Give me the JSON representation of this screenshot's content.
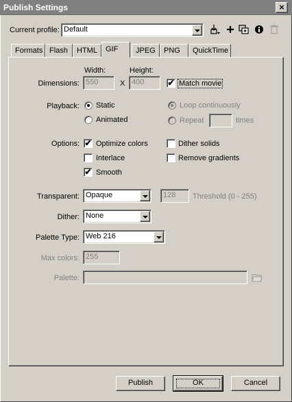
{
  "window": {
    "title": "Publish Settings",
    "close_glyph": "×"
  },
  "profile": {
    "label": "Current profile:",
    "value": "Default",
    "icons": [
      "import-export-icon",
      "add-profile-icon",
      "duplicate-profile-icon",
      "info-icon",
      "delete-profile-icon"
    ]
  },
  "tabs": [
    {
      "label": "Formats",
      "active": false
    },
    {
      "label": "Flash",
      "active": false
    },
    {
      "label": "HTML",
      "active": false
    },
    {
      "label": "GIF",
      "active": true
    },
    {
      "label": "JPEG",
      "active": false
    },
    {
      "label": "PNG",
      "active": false
    },
    {
      "label": "QuickTime",
      "active": false
    }
  ],
  "dimensions": {
    "label": "Dimensions:",
    "width_label": "Width:",
    "height_label": "Height:",
    "width_value": "550",
    "separator": "X",
    "height_value": "400",
    "match_movie_label": "Match movie",
    "match_movie_checked": true
  },
  "playback": {
    "label": "Playback:",
    "static_label": "Static",
    "animated_label": "Animated",
    "loop_label": "Loop continuously",
    "repeat_label": "Repeat",
    "repeat_value": "",
    "times_label": "times",
    "selected": "Static"
  },
  "options": {
    "label": "Options:",
    "optimize_colors": {
      "label": "Optimize colors",
      "checked": true
    },
    "interlace": {
      "label": "Interlace",
      "checked": false
    },
    "smooth": {
      "label": "Smooth",
      "checked": true
    },
    "dither_solids": {
      "label": "Dither solids",
      "checked": false
    },
    "remove_gradients": {
      "label": "Remove gradients",
      "checked": false
    }
  },
  "transparent": {
    "label": "Transparent:",
    "value": "Opaque",
    "threshold_value": "128",
    "threshold_label": "Threshold (0 - 255)"
  },
  "dither": {
    "label": "Dither:",
    "value": "None"
  },
  "palette_type": {
    "label": "Palette Type:",
    "value": "Web 216"
  },
  "max_colors": {
    "label": "Max colors:",
    "value": "255"
  },
  "palette": {
    "label": "Palette:",
    "value": ""
  },
  "buttons": {
    "publish": "Publish",
    "ok": "OK",
    "cancel": "Cancel"
  },
  "check_glyph": "✔"
}
